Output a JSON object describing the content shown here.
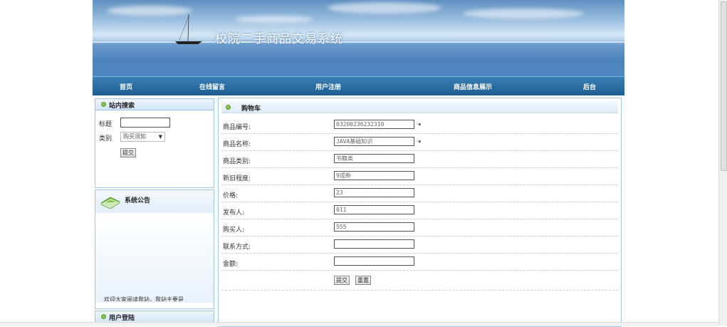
{
  "banner": {
    "title": "校院二手商品交易系统"
  },
  "nav": {
    "items": [
      "首页",
      "在线留言",
      "用户注册",
      "商品信息展示",
      "后台"
    ]
  },
  "search": {
    "title": "站内搜索",
    "label_title": "标题",
    "label_category": "类别",
    "title_value": "",
    "category_selected": "购买须知",
    "submit_label": "提交"
  },
  "notice": {
    "title": "系统公告",
    "text": "欢迎大家阅读我站，我站主要是"
  },
  "login": {
    "title": "用户登陆"
  },
  "cart": {
    "title": "购物车",
    "fields": [
      {
        "label": "商品编号:",
        "value": "03200236232310",
        "required": true
      },
      {
        "label": "商品名称:",
        "value": "JAVA基础知识",
        "required": true
      },
      {
        "label": "商品类别:",
        "value": "书籍类",
        "required": false
      },
      {
        "label": "新旧程度:",
        "value": "9成新",
        "required": false
      },
      {
        "label": "价格:",
        "value": "23",
        "required": false
      },
      {
        "label": "发布人:",
        "value": "011",
        "required": false
      },
      {
        "label": "购买人:",
        "value": "555",
        "required": false
      },
      {
        "label": "联系方式:",
        "value": "",
        "required": false
      },
      {
        "label": "金额:",
        "value": "",
        "required": false
      }
    ],
    "required_mark": "*",
    "submit_label": "提交",
    "reset_label": "重置"
  }
}
